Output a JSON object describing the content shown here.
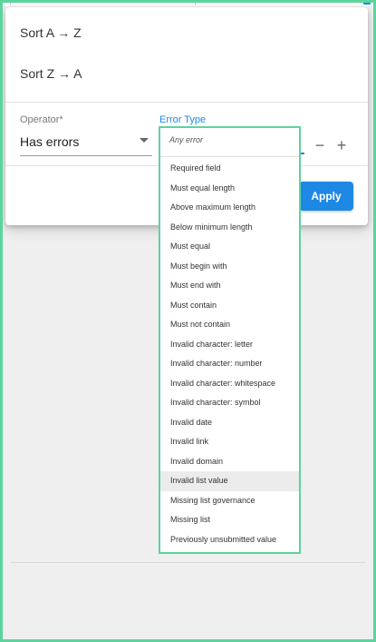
{
  "sort_menu": {
    "items": [
      {
        "label": "Sort A → Z"
      },
      {
        "label": "Sort Z → A"
      }
    ]
  },
  "filter": {
    "operator_label": "Operator",
    "required_marker": "*",
    "operator_value": "Has errors",
    "error_type_label": "Error Type",
    "remove_symbol": "−",
    "add_symbol": "+",
    "apply_label": "Apply"
  },
  "dropdown": {
    "search_placeholder": "Any error",
    "highlighted_index": 16,
    "options": [
      "Required field",
      "Must equal length",
      "Above maximum length",
      "Below minimum length",
      "Must equal",
      "Must begin with",
      "Must end with",
      "Must contain",
      "Must not contain",
      "Invalid character: letter",
      "Invalid character: number",
      "Invalid character: whitespace",
      "Invalid character: symbol",
      "Invalid date",
      "Invalid link",
      "Invalid domain",
      "Invalid list value",
      "Missing list governance",
      "Missing list",
      "Previously unsubmitted value"
    ]
  },
  "colors": {
    "accent": "#1e88e5",
    "frame": "#5dd39e",
    "highlight": "#ececec"
  }
}
